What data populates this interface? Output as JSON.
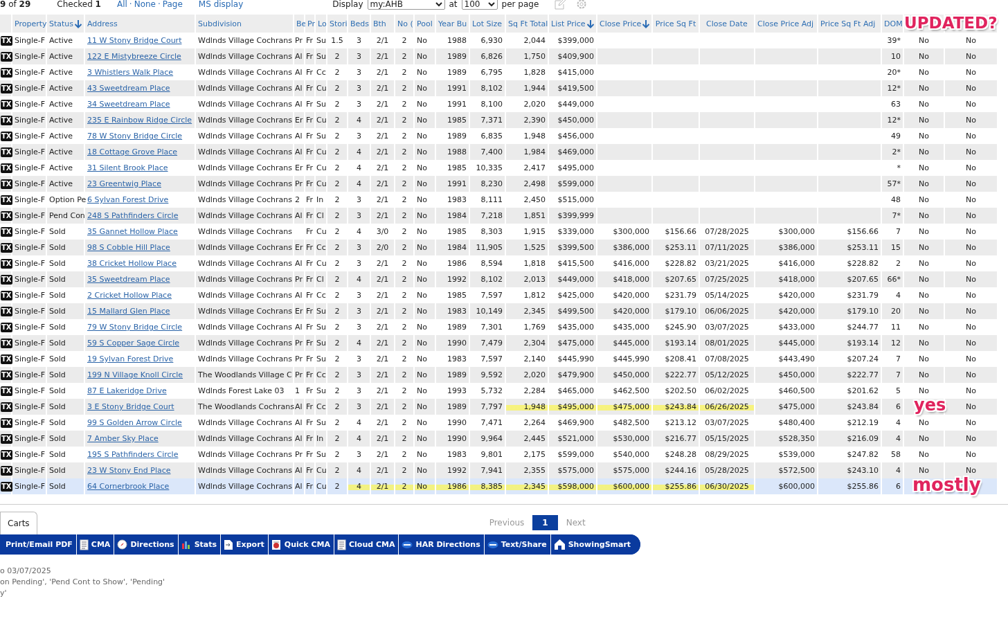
{
  "top_bar": {
    "count": "**9** of **29**",
    "checked": "Checked **1**",
    "links": [
      {
        "label": "All"
      },
      {
        "label": "·",
        "kind": "separator"
      },
      {
        "label": "None"
      },
      {
        "label": "·",
        "kind": "separator"
      },
      {
        "label": "Page"
      }
    ],
    "ms_display": "MS display",
    "display_label": "Display",
    "display_value": "my:AHB",
    "at_label": "at",
    "per_page_value": "100",
    "per_page_label": "per page"
  },
  "table": {
    "columns": [
      {},
      {
        "label": "Property"
      },
      {
        "label": "Status",
        "sorted": true
      },
      {
        "label": "Address"
      },
      {
        "label": "Subdivision"
      },
      {
        "label": "Be"
      },
      {
        "label": "Pr"
      },
      {
        "label": "Lo"
      },
      {
        "label": "Stori"
      },
      {
        "label": "Beds"
      },
      {
        "label": "Bth"
      },
      {
        "label": "No ("
      },
      {
        "label": "Pool"
      },
      {
        "label": "Year Bu"
      },
      {
        "label": "Lot Size"
      },
      {
        "label": "Sq Ft Total"
      },
      {
        "label": "List Price",
        "sorted": true
      },
      {
        "label": "Close Price",
        "sorted": true
      },
      {
        "label": "Price Sq Ft"
      },
      {
        "label": "Close Date"
      },
      {
        "label": "Close Price Adj"
      },
      {
        "label": "Price Sq Ft Adj"
      },
      {
        "label": "DOM"
      },
      {
        "note": "UPDATED?"
      },
      {}
    ],
    "rows": [
      {
        "selected": false,
        "cells": [
          "TX",
          "Single-F",
          "Active",
          "11 W Stony Bridge Court",
          "Wdlnds Village Cochrans",
          "Pr",
          "Fr",
          "Su",
          "1.5",
          "3",
          "2/1",
          "2",
          "No",
          "1988",
          "6,930",
          "2,044",
          "$399,000",
          null,
          null,
          null,
          null,
          null,
          "39*",
          "No",
          "No"
        ]
      },
      {
        "selected": false,
        "cells": [
          "TX",
          "Single-F",
          "Active",
          "122 E Mistybreeze Circle",
          "Wdlnds Village Cochrans",
          "Al",
          "Fr",
          "Su",
          "2",
          "3",
          "2/1",
          "2",
          "No",
          "1989",
          "6,826",
          "1,750",
          "$409,900",
          null,
          null,
          null,
          null,
          null,
          "10",
          "No",
          "No"
        ]
      },
      {
        "selected": false,
        "cells": [
          "TX",
          "Single-F",
          "Active",
          "3 Whistlers Walk Place",
          "Wdlnds Village Cochrans",
          "Al",
          "Fr",
          "Cc",
          "2",
          "3",
          "2/1",
          "2",
          "No",
          "1989",
          "6,795",
          "1,828",
          "$415,000",
          null,
          null,
          null,
          null,
          null,
          "20*",
          "No",
          "No"
        ]
      },
      {
        "selected": false,
        "cells": [
          "TX",
          "Single-F",
          "Active",
          "43 Sweetdream Place",
          "Wdlnds Village Cochrans",
          "Al",
          "Fr",
          "Cu",
          "2",
          "3",
          "2/1",
          "2",
          "No",
          "1991",
          "8,102",
          "1,944",
          "$419,500",
          null,
          null,
          null,
          null,
          null,
          "12*",
          "No",
          "No"
        ]
      },
      {
        "selected": false,
        "cells": [
          "TX",
          "Single-F",
          "Active",
          "34 Sweetdream Place",
          "Wdlnds Village Cochrans",
          "Al",
          "Fr",
          "Su",
          "2",
          "3",
          "2/1",
          "2",
          "No",
          "1991",
          "8,100",
          "2,020",
          "$449,000",
          null,
          null,
          null,
          null,
          null,
          "63",
          "No",
          "No"
        ]
      },
      {
        "selected": false,
        "cells": [
          "TX",
          "Single-F",
          "Active",
          "235 E Rainbow Ridge Circle",
          "Wdlnds Village Cochrans",
          "Er",
          "Fr",
          "Cu",
          "2",
          "4",
          "2/1",
          "2",
          "No",
          "1985",
          "7,371",
          "2,390",
          "$450,000",
          null,
          null,
          null,
          null,
          null,
          "12*",
          "No",
          "No"
        ]
      },
      {
        "selected": false,
        "cells": [
          "TX",
          "Single-F",
          "Active",
          "78 W Stony Bridge Circle",
          "Wdlnds Village Cochrans",
          "Al",
          "Fr",
          "Su",
          "2",
          "3",
          "2/1",
          "2",
          "No",
          "1989",
          "6,835",
          "1,948",
          "$456,000",
          null,
          null,
          null,
          null,
          null,
          "49",
          "No",
          "No"
        ]
      },
      {
        "selected": false,
        "cells": [
          "TX",
          "Single-F",
          "Active",
          "18 Cottage Grove Place",
          "Wdlnds Village Cochrans",
          "Al",
          "Fr",
          "Cu",
          "2",
          "4",
          "2/1",
          "2",
          "No",
          "1988",
          "7,400",
          "1,984",
          "$469,000",
          null,
          null,
          null,
          null,
          null,
          "2*",
          "No",
          "No"
        ]
      },
      {
        "selected": false,
        "cells": [
          "TX",
          "Single-F",
          "Active",
          "31 Silent Brook Place",
          "Wdlnds Village Cochrans",
          "Er",
          "Fr",
          "Cu",
          "2",
          "4",
          "2/1",
          "2",
          "No",
          "1985",
          "10,335",
          "2,417",
          "$495,000",
          null,
          null,
          null,
          null,
          null,
          "*",
          "No",
          "No"
        ]
      },
      {
        "selected": false,
        "cells": [
          "TX",
          "Single-F",
          "Active",
          "23 Greentwig Place",
          "Wdlnds Village Cochrans",
          "Pr",
          "Fr",
          "Cu",
          "2",
          "4",
          "2/1",
          "2",
          "No",
          "1991",
          "8,230",
          "2,498",
          "$599,000",
          null,
          null,
          null,
          null,
          null,
          "57*",
          "No",
          "No"
        ]
      },
      {
        "selected": false,
        "cells": [
          "TX",
          "Single-F",
          "Option Pe",
          "6 Sylvan Forest Drive",
          "Wdlnds Village Cochrans",
          "2",
          "Fr",
          "In",
          "2",
          "3",
          "2/1",
          "2",
          "No",
          "1983",
          "8,111",
          "2,450",
          "$515,000",
          null,
          null,
          null,
          null,
          null,
          "48",
          "No",
          "No"
        ]
      },
      {
        "selected": false,
        "cells": [
          "TX",
          "Single-F",
          "Pend Con",
          "248 S Pathfinders Circle",
          "Wdlnds Village Cochrans",
          "Al",
          "Fr",
          "Cl",
          "2",
          "3",
          "2/1",
          "2",
          "No",
          "1984",
          "7,218",
          "1,851",
          "$399,999",
          null,
          null,
          null,
          null,
          null,
          "7*",
          "No",
          "No"
        ]
      },
      {
        "selected": false,
        "cells": [
          "TX",
          "Single-F",
          "Sold",
          "35 Gannet Hollow Place",
          "Wdlnds Village Cochrans",
          null,
          "Fr",
          "Cu",
          "2",
          "4",
          "3/0",
          "2",
          "No",
          "1985",
          "8,303",
          "1,915",
          "$339,000",
          "$300,000",
          "$156.66",
          "07/28/2025",
          "$300,000",
          "$156.66",
          "7",
          "No",
          "No"
        ]
      },
      {
        "selected": false,
        "cells": [
          "TX",
          "Single-F",
          "Sold",
          "98 S Cobble Hill Place",
          "Wdlnds Village Cochrans",
          "Er",
          "Fr",
          "Cc",
          "2",
          "3",
          "2/0",
          "2",
          "No",
          "1984",
          "11,905",
          "1,525",
          "$399,500",
          "$386,000",
          "$253.11",
          "07/11/2025",
          "$386,000",
          "$253.11",
          "15",
          "No",
          "No"
        ]
      },
      {
        "selected": false,
        "cells": [
          "TX",
          "Single-F",
          "Sold",
          "38 Cricket Hollow Place",
          "Wdlnds Village Cochrans",
          "Al",
          "Fr",
          "Cu",
          "2",
          "3",
          "2/1",
          "2",
          "No",
          "1986",
          "8,594",
          "1,818",
          "$415,500",
          "$416,000",
          "$228.82",
          "03/21/2025",
          "$416,000",
          "$228.82",
          "2",
          "No",
          "No"
        ]
      },
      {
        "selected": false,
        "cells": [
          "TX",
          "Single-F",
          "Sold",
          "35 Sweetdream Place",
          "Wdlnds Village Cochrans",
          "Pr",
          "Fr",
          "Cl",
          "2",
          "4",
          "2/1",
          "2",
          "No",
          "1992",
          "8,102",
          "2,013",
          "$449,000",
          "$418,000",
          "$207.65",
          "07/25/2025",
          "$418,000",
          "$207.65",
          "66*",
          "No",
          "No"
        ]
      },
      {
        "selected": false,
        "cells": [
          "TX",
          "Single-F",
          "Sold",
          "2 Cricket Hollow Place",
          "Wdlnds Village Cochrans",
          "Al",
          "Fr",
          "Cc",
          "2",
          "3",
          "2/1",
          "2",
          "No",
          "1985",
          "7,597",
          "1,812",
          "$425,000",
          "$420,000",
          "$231.79",
          "05/14/2025",
          "$420,000",
          "$231.79",
          "4",
          "No",
          "No"
        ]
      },
      {
        "selected": false,
        "cells": [
          "TX",
          "Single-F",
          "Sold",
          "15 Mallard Glen Place",
          "Wdlnds Village Cochrans",
          "Er",
          "Fr",
          "Su",
          "2",
          "3",
          "2/1",
          "2",
          "No",
          "1983",
          "10,149",
          "2,345",
          "$499,500",
          "$420,000",
          "$179.10",
          "06/06/2025",
          "$420,000",
          "$179.10",
          "20",
          "No",
          "No"
        ]
      },
      {
        "selected": false,
        "cells": [
          "TX",
          "Single-F",
          "Sold",
          "79 W Stony Bridge Circle",
          "Wdlnds Village Cochrans",
          "Al",
          "Fr",
          "Su",
          "2",
          "3",
          "2/1",
          "2",
          "No",
          "1989",
          "7,301",
          "1,769",
          "$435,000",
          "$435,000",
          "$245.90",
          "03/07/2025",
          "$433,000",
          "$244.77",
          "11",
          "No",
          "No"
        ]
      },
      {
        "selected": false,
        "cells": [
          "TX",
          "Single-F",
          "Sold",
          "59 S Copper Sage Circle",
          "Wdlnds Village Cochrans",
          "Pr",
          "Fr",
          "Su",
          "2",
          "4",
          "2/1",
          "2",
          "No",
          "1990",
          "7,479",
          "2,304",
          "$475,000",
          "$445,000",
          "$193.14",
          "08/01/2025",
          "$445,000",
          "$193.14",
          "12",
          "No",
          "No"
        ]
      },
      {
        "selected": false,
        "cells": [
          "TX",
          "Single-F",
          "Sold",
          "19 Sylvan Forest Drive",
          "Wdlnds Village Cochrans",
          "Pr",
          "Fr",
          "Su",
          "2",
          "3",
          "2/1",
          "2",
          "No",
          "1983",
          "7,597",
          "2,140",
          "$445,990",
          "$445,990",
          "$208.41",
          "07/08/2025",
          "$443,490",
          "$207.24",
          "7",
          "No",
          "No"
        ]
      },
      {
        "selected": false,
        "cells": [
          "TX",
          "Single-F",
          "Sold",
          "199 N Village Knoll Circle",
          "The Woodlands Village C",
          "Pr",
          "Fr",
          "Cc",
          "2",
          "3",
          "2/1",
          "2",
          "No",
          "1989",
          "9,592",
          "2,020",
          "$479,900",
          "$450,000",
          "$222.77",
          "05/12/2025",
          "$450,000",
          "$222.77",
          "7",
          "No",
          "No"
        ]
      },
      {
        "selected": false,
        "cells": [
          "TX",
          "Single-F",
          "Sold",
          "87 E Lakeridge Drive",
          "Wdlnds Forest Lake 03",
          "1",
          "Fr",
          "Su",
          "2",
          "3",
          "2/1",
          "2",
          "No",
          "1993",
          "5,732",
          "2,284",
          "$465,000",
          "$462,500",
          "$202.50",
          "06/02/2025",
          "$460,500",
          "$201.62",
          "5",
          "No",
          "No"
        ]
      },
      {
        "selected": false,
        "cells": [
          "TX",
          "Single-F",
          "Sold",
          "3 E Stony Bridge Court",
          "The Woodlands Cochrans",
          "Al",
          "Fr",
          "Cc",
          "2",
          "3",
          "2/1",
          "2",
          "No",
          "1989",
          "7,797",
          {
            "text": "1,948",
            "highlighted": true
          },
          {
            "text": "$495,000",
            "highlighted": true
          },
          {
            "text": "$475,000",
            "highlighted": true
          },
          {
            "text": "$243.84",
            "highlighted": true
          },
          {
            "text": "06/26/2025",
            "highlighted": true
          },
          "$475,000",
          "$243.84",
          "6",
          {
            "note": "yes"
          },
          "No"
        ]
      },
      {
        "selected": false,
        "cells": [
          "TX",
          "Single-F",
          "Sold",
          "99 S Golden Arrow Circle",
          "Wdlnds Village Cochrans",
          "Al",
          "Fr",
          "Su",
          "2",
          "4",
          "2/1",
          "2",
          "No",
          "1990",
          "7,471",
          "2,264",
          "$469,900",
          "$482,500",
          "$213.12",
          "03/07/2025",
          "$480,400",
          "$212.19",
          "4",
          "No",
          "No"
        ]
      },
      {
        "selected": false,
        "cells": [
          "TX",
          "Single-F",
          "Sold",
          "7 Amber Sky Place",
          "Wdlnds Village Cochrans",
          "Al",
          "Fr",
          "In",
          "2",
          "4",
          "2/1",
          "2",
          "No",
          "1990",
          "9,964",
          "2,445",
          "$521,000",
          "$530,000",
          "$216.77",
          "05/15/2025",
          "$528,350",
          "$216.09",
          "4",
          "No",
          "No"
        ]
      },
      {
        "selected": false,
        "cells": [
          "TX",
          "Single-F",
          "Sold",
          "195 S Pathfinders Circle",
          "Wdlnds Village Cochrans",
          "Pr",
          "Fr",
          "Su",
          "2",
          "3",
          "2/1",
          "2",
          "No",
          "1983",
          "9,801",
          "2,175",
          "$599,000",
          "$540,000",
          "$248.28",
          "08/29/2025",
          "$539,000",
          "$247.82",
          "58",
          "No",
          "No"
        ]
      },
      {
        "selected": false,
        "cells": [
          "TX",
          "Single-F",
          "Sold",
          "23 W Stony End Place",
          "Wdlnds Village Cochrans",
          "Al",
          "Fr",
          "Cu",
          "2",
          "4",
          "2/1",
          "2",
          "No",
          "1992",
          "7,941",
          "2,355",
          "$575,000",
          "$575,000",
          "$244.16",
          "05/28/2025",
          "$572,500",
          "$243.10",
          "4",
          "No",
          "No"
        ]
      },
      {
        "selected": true,
        "cells": [
          "TX",
          "Single-F",
          "Sold",
          "64 Cornerbrook Place",
          "Wdlnds Village Cochrans",
          "Al",
          "Fr",
          "Cu",
          "2",
          {
            "text": "4",
            "highlighted": true
          },
          {
            "text": "2/1",
            "highlighted": true
          },
          {
            "text": "2",
            "highlighted": true
          },
          {
            "text": "No",
            "highlighted": true
          },
          {
            "text": "1986",
            "highlighted": true
          },
          {
            "text": "8,385",
            "highlighted": true
          },
          {
            "text": "2,345",
            "highlighted": true
          },
          {
            "text": "$598,000",
            "highlighted": true
          },
          {
            "text": "$600,000",
            "highlighted": true
          },
          {
            "text": "$255.86",
            "highlighted": true
          },
          {
            "text": "06/30/2025",
            "highlighted": true
          },
          "$600,000",
          "$255.86",
          "6",
          {
            "note": "mostly"
          },
          null
        ]
      }
    ]
  },
  "tabs": [
    {
      "label": "Carts",
      "selected": true
    }
  ],
  "pagination": {
    "previous": "Previous",
    "pages": [
      {
        "label": "1",
        "selected": true
      }
    ],
    "next": "Next"
  },
  "toolbar": [
    {
      "label": "Print/Email PDF"
    },
    {
      "label": "CMA",
      "kind": "notebook"
    },
    {
      "label": "Directions",
      "kind": "compass"
    },
    {
      "label": "Stats",
      "kind": "chart"
    },
    {
      "label": "Export",
      "kind": "export"
    },
    {
      "label": "Quick CMA",
      "kind": "quick"
    },
    {
      "label": "Cloud CMA",
      "kind": "notebook"
    },
    {
      "label": "HAR Directions",
      "kind": "har"
    },
    {
      "label": "Text/Share",
      "kind": "har"
    },
    {
      "label": "ShowingSmart",
      "kind": "house"
    }
  ],
  "notes": [
    "o 03/07/2025",
    "on Pending', 'Pend Cont to Show', 'Pending'",
    "y'"
  ]
}
